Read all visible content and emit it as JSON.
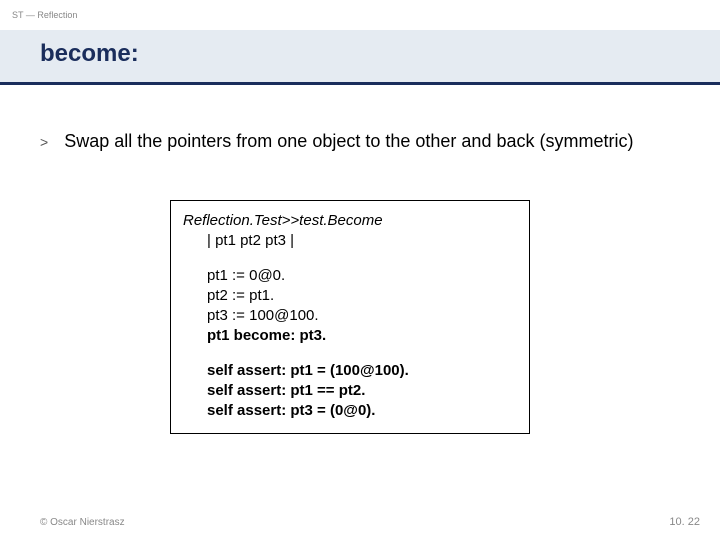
{
  "header": {
    "label": "ST — Reflection"
  },
  "title": "become:",
  "bullet": {
    "marker": ">",
    "text": "Swap all the pointers from one object to the other and back (symmetric)"
  },
  "code": {
    "signature": "Reflection.Test>>test.Become",
    "vars": "| pt1 pt2 pt3 |",
    "line1": "pt1 := 0@0.",
    "line2": "pt2 := pt1.",
    "line3": "pt3 := 100@100.",
    "line4": "pt1 become: pt3.",
    "assert1": "self assert: pt1 = (100@100).",
    "assert2": "self assert: pt1 == pt2.",
    "assert3": "self assert: pt3 = (0@0)."
  },
  "footer": {
    "left": "© Oscar Nierstrasz",
    "right": "10. 22"
  }
}
